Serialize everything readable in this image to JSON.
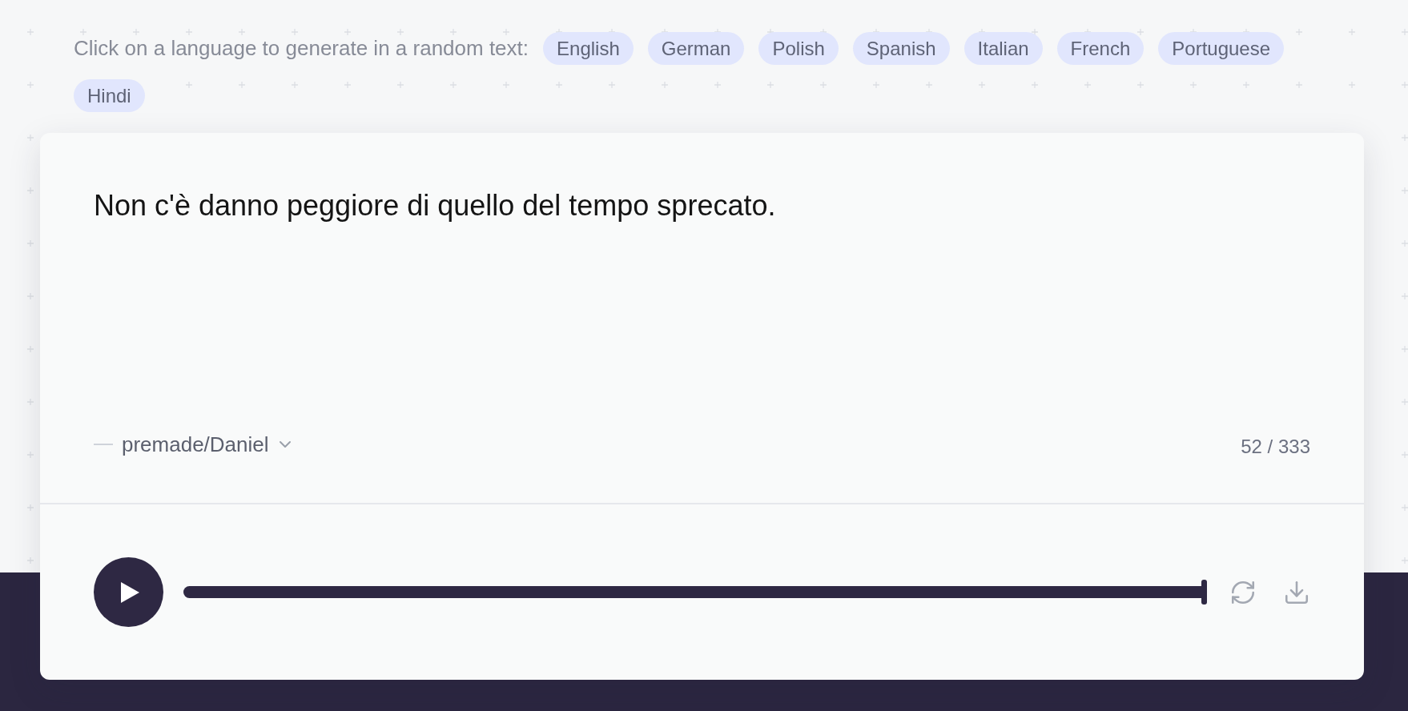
{
  "prompt": {
    "text": "Click on a language to generate in a random text:"
  },
  "languages": [
    {
      "label": "English"
    },
    {
      "label": "German"
    },
    {
      "label": "Polish"
    },
    {
      "label": "Spanish"
    },
    {
      "label": "Italian"
    },
    {
      "label": "French"
    },
    {
      "label": "Portuguese"
    },
    {
      "label": "Hindi"
    }
  ],
  "editor": {
    "text": "Non c'è danno peggiore di quello del tempo sprecato.",
    "voice": "premade/Daniel",
    "char_count": "52 / 333"
  },
  "player": {
    "playing": false,
    "level": 1
  }
}
